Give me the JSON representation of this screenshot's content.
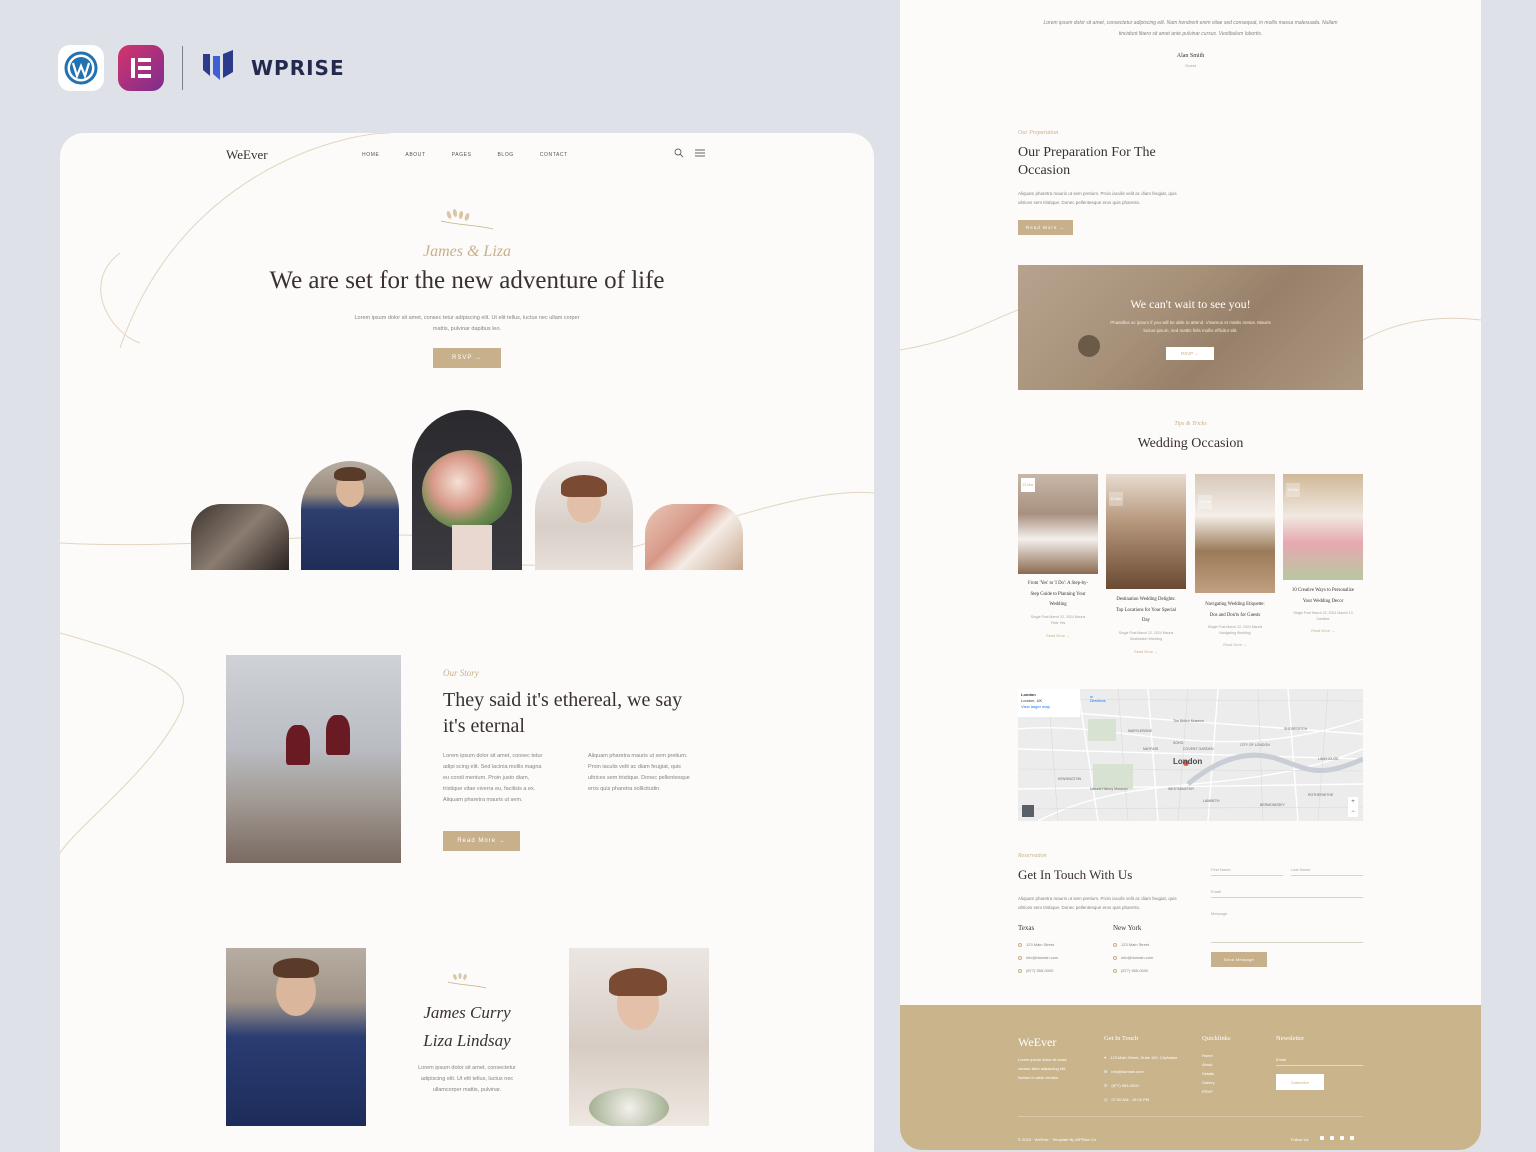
{
  "brand": {
    "wordpress_icon": "wordpress-icon",
    "elementor_icon": "elementor-icon",
    "wprise_icon": "wprise-icon",
    "wprise_text": "WPRISE"
  },
  "colors": {
    "gold": "#c7b08a",
    "footer_gold": "#c9b48c",
    "page_bg": "#dfe1e8",
    "card_bg": "#fcfbf9",
    "text_dark": "#3a3030"
  },
  "left": {
    "nav": {
      "logo": "WeEver",
      "links": [
        "HOME",
        "ABOUT",
        "PAGES",
        "BLOG",
        "CONTACT"
      ],
      "search_icon": "search-icon",
      "menu_icon": "hamburger-menu-icon"
    },
    "hero": {
      "couple": "James & Liza",
      "title": "We are set for the new adventure of life",
      "text_line1": "Lorem ipsum dolor sit amet, consec tetur adipiscing elit. Ut elit tellus, luctus nec ullam corper",
      "text_line2": "mattis, pulvinar dapibus leo.",
      "button": "RSVP →"
    },
    "story": {
      "eyebrow": "Our Story",
      "title_line1": "They said it's ethereal, we say",
      "title_line2": "it's eternal",
      "col1": [
        "Lorem ipsum dolor sit amet, consec tetur",
        "adipi scing elit. Sed lacinia mollis magna",
        "eu condi mentum. Proin justo diam,",
        "tristique vitae viverra eu, facilisis a ex.",
        "Aliquam pharetra mauris ut sem."
      ],
      "col2": [
        "Aliquam pharetra mauris ut sem pretium.",
        "Proin iaculis velit ac diam feugiat, quis",
        "ultrices sem tristique. Donec pellentesque",
        "eros quis pharetra sollicitudin."
      ],
      "button": "Read More →"
    },
    "couple": {
      "name1": "James Curry",
      "name2": "Liza Lindsay",
      "text": [
        "Lorem ipsum dolor sit amet, consectetur",
        "adipiscing elit. Ut elit tellus, luctus nec",
        "ullamcorper mattis, pulvinar."
      ]
    }
  },
  "right": {
    "testimonial": {
      "text_line1": "Lorem ipsum dolor sit amet, consectetur adipiscing elit. Nam hendrerit enim vitae sed consequat, in mollis massa malesuada. Nullam",
      "text_line2": "tincidunt libero sit amet ante pulvinar cursus. Vestibulum lobortis.",
      "name": "Alan Smith",
      "role": "Guest"
    },
    "preparation": {
      "eyebrow": "Our Preparation",
      "title_line1": "Our Preparation For The",
      "title_line2": "Occasion",
      "text_line1": "Aliquam pharetra mauris ut sem pretium. Proin iaculis velit ac diam feugiat, quis",
      "text_line2": "ultrices sem tristique. Donec pellentesque eros quis pharetra.",
      "button": "Read More →"
    },
    "banner": {
      "title": "We can't wait to see you!",
      "text_line1": "Phasellus ac ipsum if you will be able to attend. Vivamus et mattis metus. Mauris",
      "text_line2": "luctus ipsum, sed mattis felis mollis efficitur elit.",
      "button": "RSVP →"
    },
    "blog": {
      "eyebrow": "Tips & Tricks",
      "title": "Wedding Occasion",
      "posts": [
        {
          "date": "22 Mar",
          "title": [
            "From 'Yes' to 'I Do': A Step-by-",
            "Step Guide to Planning Your",
            "Wedding"
          ],
          "meta": [
            "Single Post March 22, 2024 Mauris",
            "Fiber Yes"
          ],
          "link": "Read More →"
        },
        {
          "date": "22 Mar",
          "title": [
            "Destination Wedding Delights:",
            "Top Locations for Your Special",
            "Day"
          ],
          "meta": [
            "Single Post March 22, 2024 Mauris",
            "Destination Wedding"
          ],
          "link": "Read More →"
        },
        {
          "date": "22 Mar",
          "title": [
            "Navigating Wedding Etiquette:",
            "Dos and Don'ts for Guests"
          ],
          "meta": [
            "Single Post March 22, 2024 Mauris",
            "Navigating Wedding"
          ],
          "link": "Read More →"
        },
        {
          "date": "22 Mar",
          "title": [
            "10 Creative Ways to Personalize",
            "Your Wedding Decor"
          ],
          "meta": [
            "Single Post March 22, 2024 Mauris 10",
            "Creative"
          ],
          "link": "Read More →"
        }
      ]
    },
    "map": {
      "city": "London",
      "place_label": "London",
      "place_sub": "London, UK",
      "larger_map": "View larger map",
      "directions": "Directions",
      "labels": [
        "MARYLEBONE",
        "SOHO",
        "COVENT GARDEN",
        "MAYFAIR",
        "CITY OF LONDON",
        "KENSINGTON",
        "WESTMINSTER",
        "LAMBETH",
        "BERMONDSEY",
        "ROTHERHITHE",
        "SHOREDITCH",
        "LIMEHOUSE",
        "Natural History Museum",
        "The British Museum"
      ],
      "zoom_in": "+",
      "zoom_out": "−"
    },
    "contact": {
      "eyebrow": "Reservation",
      "title": "Get In Touch With Us",
      "text_line1": "Aliquam pharetra mauris ut sem pretium. Proin iaculis velit ac diam feugiat, quis",
      "text_line2": "ultrices sem tristique. Donec pellentesque eros quis pharetra.",
      "office1": {
        "name": "Texas",
        "address": "123 Main Street",
        "email": "info@domain.com",
        "phone": "(877) 555-0000"
      },
      "office2": {
        "name": "New York",
        "address": "123 Main Street",
        "email": "info@domain.com",
        "phone": "(877) 555-0000"
      },
      "form": {
        "first_name": "First Name",
        "last_name": "Last Name",
        "email": "Email",
        "message": "Message",
        "submit": "Send Message"
      }
    },
    "footer": {
      "logo": "WeEver",
      "about": [
        "Lorem ipsum dolor sit amet,",
        "consec tetur adipiscing elit.",
        "Nullam in wide veniam."
      ],
      "col_touch_title": "Get In Touch",
      "touch_items": [
        "123 Main Street, Suite 100, CityName",
        "info@domain.com",
        "(877) 555-0000",
        "07.00 AM - 19.00 PM"
      ],
      "col_links_title": "Quicklinks",
      "links": [
        "Home",
        "About",
        "Details",
        "Gallery",
        "RSVP"
      ],
      "col_news_title": "Newsletter",
      "email_placeholder": "Email",
      "subscribe": "Subscribe",
      "copyright": "© 2024 · WeEver · Template By WPRise.Co",
      "follow": "Follow Us"
    }
  }
}
